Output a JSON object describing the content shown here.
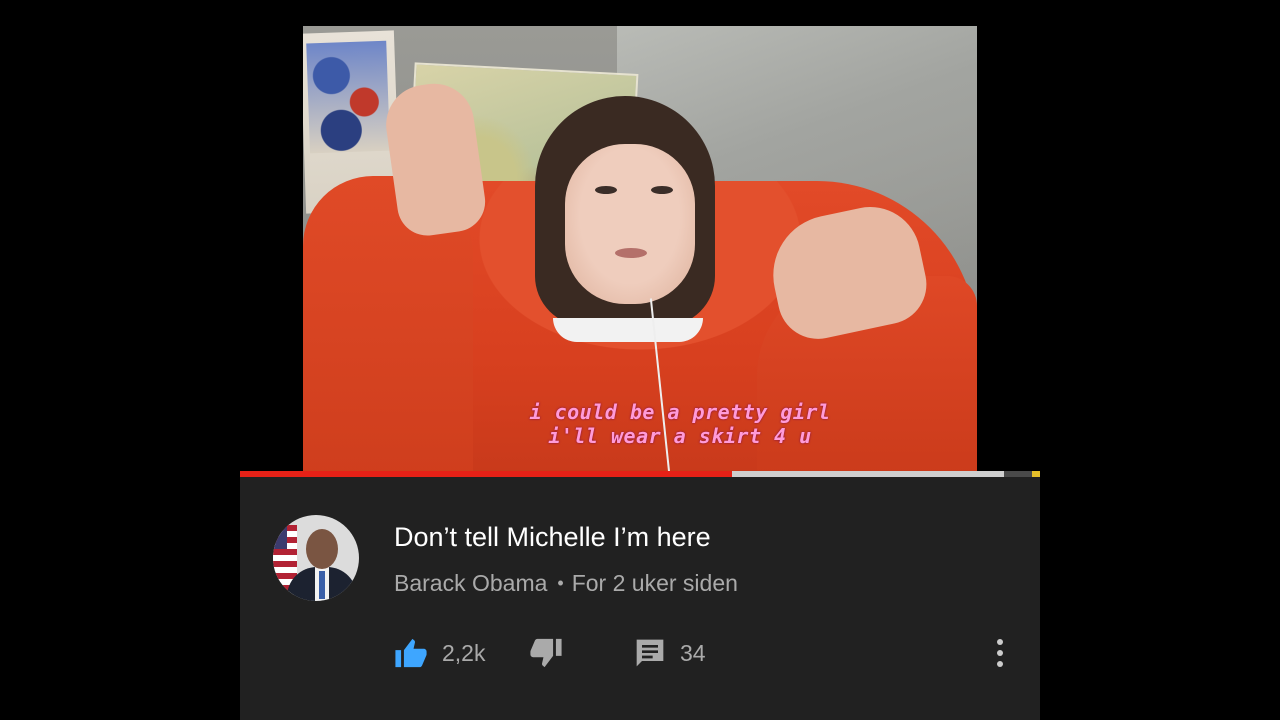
{
  "video": {
    "caption_line1": "i could be a pretty girl",
    "caption_line2": "i'll wear a skirt 4 u",
    "played_fraction": 0.615,
    "buffered_fraction": 0.955
  },
  "info": {
    "title": "Don’t tell Michelle I’m here",
    "channel": "Barack Obama",
    "separator": "•",
    "posted": "For 2 uker siden"
  },
  "actions": {
    "likes": "2,2k",
    "comments": "34"
  },
  "colors": {
    "like_active": "#3ea6ff",
    "progress_played": "#e62117",
    "panel_bg": "#212121"
  },
  "icons": {
    "like": "thumbs-up-icon",
    "dislike": "thumbs-down-icon",
    "comments": "comment-icon",
    "more": "more-vertical-icon"
  }
}
